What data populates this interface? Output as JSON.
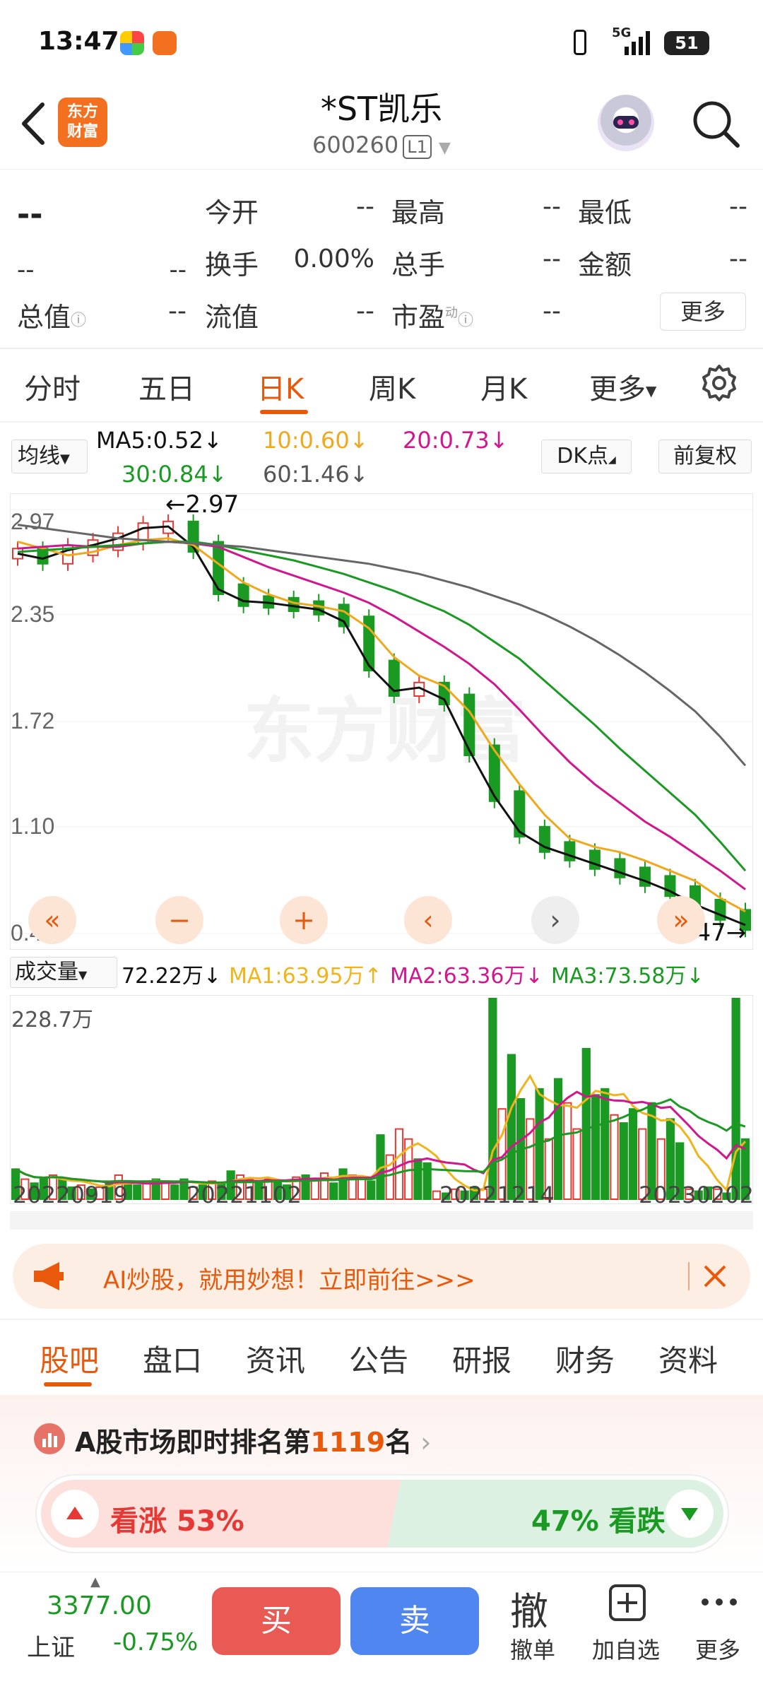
{
  "status_bar": {
    "time": "13:47",
    "network": "5G",
    "battery": "51"
  },
  "header": {
    "back_icon": "back-arrow-icon",
    "logo_text": "东方\n财富",
    "title": "*ST凯乐",
    "code": "600260",
    "level": "L1"
  },
  "quote": {
    "price": "--",
    "change": "--",
    "change_pct": "--",
    "rows": [
      {
        "a_label": "今开",
        "a_val": "--",
        "b_label": "最高",
        "b_val": "--",
        "c_label": "最低",
        "c_val": "--"
      },
      {
        "a_label": "换手",
        "a_val": "0.00%",
        "b_label": "总手",
        "b_val": "--",
        "c_label": "金额",
        "c_val": "--"
      },
      {
        "a_label": "流值",
        "a_val": "--",
        "b_label": "市盈",
        "b_val": "--"
      }
    ],
    "total_value_label": "总值",
    "total_value": "--",
    "pe_sup": "动",
    "more_button": "更多"
  },
  "ktabs": [
    {
      "label": "分时",
      "active": false
    },
    {
      "label": "五日",
      "active": false
    },
    {
      "label": "日K",
      "active": true
    },
    {
      "label": "周K",
      "active": false
    },
    {
      "label": "月K",
      "active": false
    },
    {
      "label": "更多",
      "active": false
    }
  ],
  "chart_controls": {
    "ma_select": "均线",
    "dk_button": "DK点",
    "adjust_button": "前复权"
  },
  "ma_legend": {
    "ma5": "MA5:0.52↓",
    "ma10": "10:0.60↓",
    "ma20": "20:0.73↓",
    "ma30": "30:0.84↓",
    "ma60": "60:1.46↓"
  },
  "colors": {
    "accent": "#e8590c",
    "up": "#e53935",
    "down": "#1a9a23",
    "ma5": "#111111",
    "ma10": "#f0a81c",
    "ma20": "#d1168e",
    "ma30": "#1a9a23",
    "ma60": "#666666"
  },
  "chart_data": {
    "type": "line",
    "y_ticks": [
      "2.97",
      "2.35",
      "1.72",
      "1.10",
      "0.47"
    ],
    "ylim": [
      0.47,
      2.97
    ],
    "high_label": "2.97",
    "low_label": "0.47",
    "watermark": "东方财富",
    "x_ticks": [
      "20220919",
      "20221102",
      "20221214",
      "20230202"
    ],
    "series": [
      {
        "name": "MA5",
        "values": [
          2.71,
          2.68,
          2.73,
          2.76,
          2.8,
          2.86,
          2.87,
          2.75,
          2.5,
          2.43,
          2.42,
          2.4,
          2.38,
          2.31,
          2.05,
          1.9,
          1.92,
          1.85,
          1.55,
          1.28,
          1.07,
          0.98,
          0.93,
          0.88,
          0.83,
          0.78,
          0.72,
          0.64,
          0.58,
          0.52
        ]
      },
      {
        "name": "10",
        "values": [
          2.78,
          2.74,
          2.7,
          2.72,
          2.76,
          2.79,
          2.8,
          2.76,
          2.65,
          2.54,
          2.47,
          2.42,
          2.4,
          2.37,
          2.27,
          2.1,
          1.99,
          1.93,
          1.78,
          1.55,
          1.35,
          1.17,
          1.03,
          0.98,
          0.95,
          0.9,
          0.84,
          0.78,
          0.68,
          0.6
        ]
      },
      {
        "name": "20",
        "values": [
          2.74,
          2.75,
          2.76,
          2.75,
          2.75,
          2.77,
          2.78,
          2.77,
          2.75,
          2.69,
          2.63,
          2.58,
          2.53,
          2.48,
          2.42,
          2.34,
          2.25,
          2.16,
          2.06,
          1.94,
          1.79,
          1.63,
          1.48,
          1.35,
          1.24,
          1.13,
          1.04,
          0.94,
          0.84,
          0.73
        ]
      },
      {
        "name": "30",
        "values": [
          2.72,
          2.73,
          2.74,
          2.75,
          2.76,
          2.77,
          2.78,
          2.78,
          2.76,
          2.73,
          2.7,
          2.67,
          2.63,
          2.59,
          2.54,
          2.49,
          2.43,
          2.37,
          2.29,
          2.19,
          2.09,
          1.96,
          1.83,
          1.7,
          1.56,
          1.43,
          1.3,
          1.17,
          1.01,
          0.84
        ]
      },
      {
        "name": "60",
        "values": [
          2.88,
          2.86,
          2.84,
          2.82,
          2.8,
          2.79,
          2.78,
          2.77,
          2.76,
          2.75,
          2.73,
          2.71,
          2.69,
          2.67,
          2.65,
          2.62,
          2.59,
          2.55,
          2.51,
          2.46,
          2.41,
          2.35,
          2.28,
          2.2,
          2.11,
          2.01,
          1.9,
          1.78,
          1.63,
          1.46
        ]
      }
    ]
  },
  "volume": {
    "select": "成交量",
    "value": "72.22万↓",
    "ma1": "MA1:63.95万↑",
    "ma2": "MA2:63.36万↓",
    "ma3": "MA3:73.58万↓",
    "max_label": "228.7万",
    "bars": [
      0.15,
      0.1,
      0.08,
      0.1,
      0.12,
      0.1,
      0.06,
      0.07,
      0.05,
      0.06,
      0.08,
      0.12,
      0.08,
      0.07,
      0.09,
      0.1,
      0.09,
      0.07,
      0.1,
      0.06,
      0.07,
      0.09,
      0.08,
      0.14,
      0.12,
      0.1,
      0.08,
      0.1,
      0.09,
      0.07,
      0.11,
      0.12,
      0.1,
      0.13,
      0.08,
      0.15,
      0.12,
      0.1,
      0.09,
      0.32,
      0.22,
      0.35,
      0.3,
      0.2,
      0.18,
      0.04,
      0.03,
      0.05,
      0.04,
      0.06,
      0.05,
      1.0,
      0.45,
      0.72,
      0.5,
      0.4,
      0.55,
      0.3,
      0.6,
      0.48,
      0.35,
      0.75,
      0.52,
      0.55,
      0.42,
      0.38,
      0.45,
      0.35,
      0.48,
      0.3,
      0.4,
      0.28,
      0.05,
      0.04,
      0.06,
      0.05,
      0.03,
      1.0,
      0.3
    ],
    "bar_up": [
      0,
      1,
      0,
      0,
      1,
      0,
      0,
      1,
      0,
      1,
      0,
      1,
      0,
      0,
      1,
      0,
      1,
      0,
      0,
      1,
      0,
      1,
      0,
      0,
      1,
      1,
      0,
      1,
      0,
      0,
      1,
      0,
      1,
      1,
      0,
      0,
      1,
      1,
      0,
      0,
      1,
      1,
      1,
      0,
      0,
      1,
      0,
      1,
      0,
      0,
      1,
      0,
      1,
      0,
      0,
      1,
      0,
      1,
      0,
      1,
      1,
      0,
      0,
      0,
      1,
      0,
      0,
      1,
      0,
      1,
      0,
      0,
      1,
      0,
      0,
      1,
      0,
      0,
      0
    ]
  },
  "ai_banner": {
    "text": "AI炒股，就用妙想！立即前往>>>"
  },
  "section_tabs": [
    {
      "label": "股吧",
      "active": true
    },
    {
      "label": "盘口",
      "active": false
    },
    {
      "label": "资讯",
      "active": false
    },
    {
      "label": "公告",
      "active": false
    },
    {
      "label": "研报",
      "active": false
    },
    {
      "label": "财务",
      "active": false
    },
    {
      "label": "资料",
      "active": false
    }
  ],
  "ranking": {
    "prefix": "A股市场即时排名第",
    "rank": "1119",
    "suffix": "名"
  },
  "sentiment": {
    "bull_label": "看涨 53%",
    "bear_label": "47% 看跌",
    "bull_pct": 53
  },
  "bottom_bar": {
    "index_value": "3377.00",
    "index_name": "上证",
    "index_change": "-0.75%",
    "buy": "买",
    "sell": "卖",
    "cancel_glyph": "撤",
    "cancel": "撤单",
    "add_watch": "加自选",
    "more": "更多"
  }
}
